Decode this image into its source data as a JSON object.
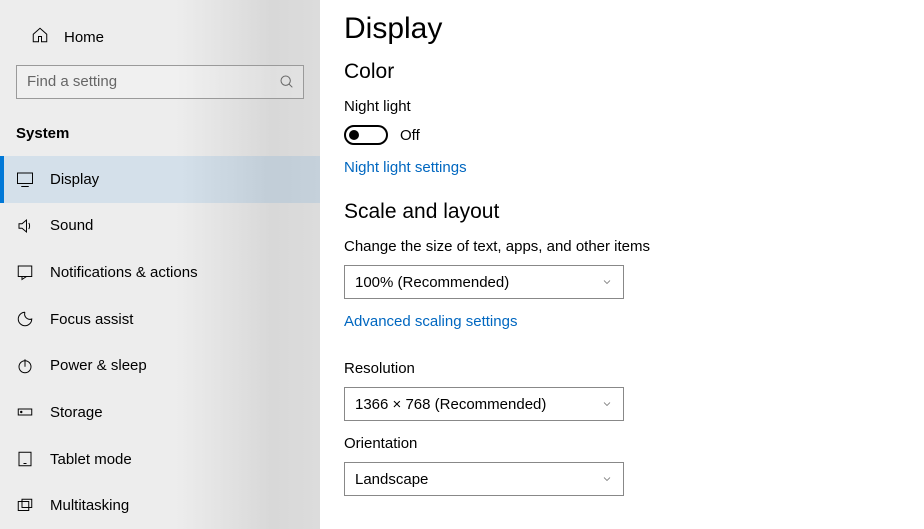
{
  "home_label": "Home",
  "search_placeholder": "Find a setting",
  "sidebar_section": "System",
  "nav": {
    "display": "Display",
    "sound": "Sound",
    "notifications": "Notifications & actions",
    "focus": "Focus assist",
    "power": "Power & sleep",
    "storage": "Storage",
    "tablet": "Tablet mode",
    "multitasking": "Multitasking"
  },
  "page_title": "Display",
  "color": {
    "heading": "Color",
    "night_light_label": "Night light",
    "night_light_state": "Off",
    "night_light_link": "Night light settings"
  },
  "scale": {
    "heading": "Scale and layout",
    "size_label": "Change the size of text, apps, and other items",
    "size_value": "100% (Recommended)",
    "advanced_link": "Advanced scaling settings",
    "resolution_label": "Resolution",
    "resolution_value": "1366 × 768 (Recommended)",
    "orientation_label": "Orientation",
    "orientation_value": "Landscape"
  }
}
